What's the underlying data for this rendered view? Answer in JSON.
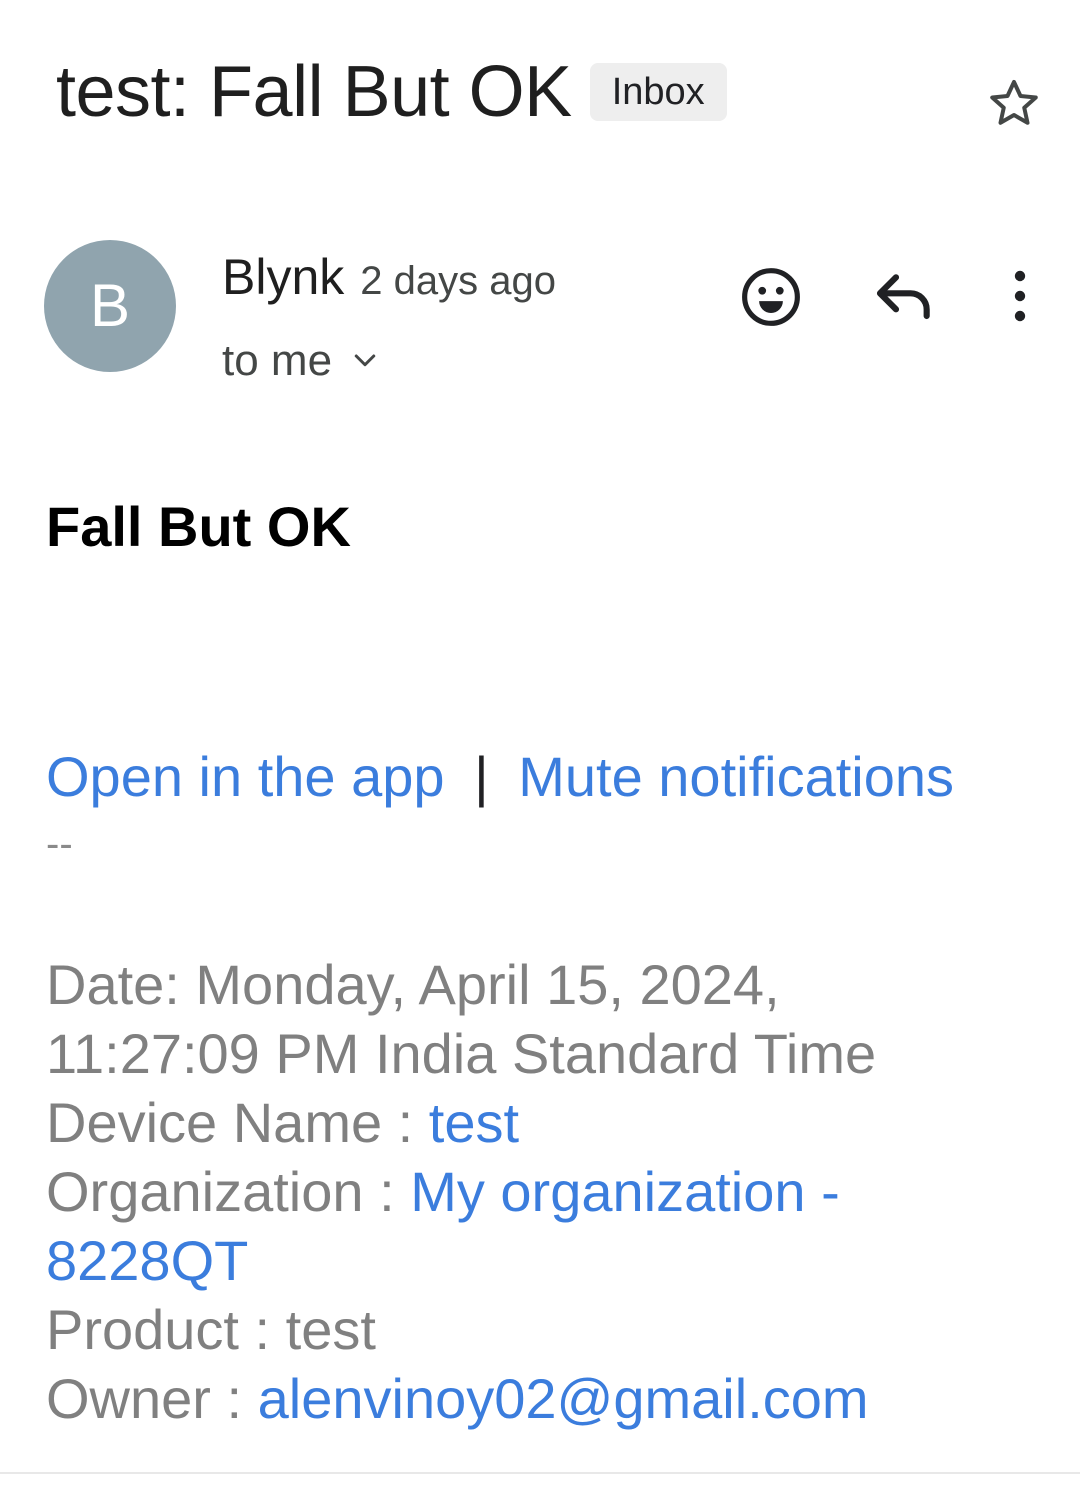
{
  "header": {
    "subject": "test: Fall But OK",
    "label": "Inbox"
  },
  "sender": {
    "initial": "B",
    "name": "Blynk",
    "time": "2 days ago",
    "recipient": "to me",
    "avatar_color": "#90a4ae"
  },
  "icons": {
    "star": "star-icon",
    "emoji": "emoji-icon",
    "reply": "reply-icon",
    "more": "more-vert-icon",
    "expand": "chevron-down-icon"
  },
  "message": {
    "headline": "Fall But OK",
    "link_open": "Open in the app",
    "separator": "|",
    "link_mute": "Mute notifications",
    "signature_dashes": "--",
    "date_label": "Date: Monday, April 15, 2024,",
    "date_time": "11:27:09 PM India Standard Time",
    "device_label": "Device Name : ",
    "device_value": "test",
    "org_label": "Organization : ",
    "org_value_line1": "My organization -",
    "org_value_line2": "8228QT",
    "product_line": "Product : test",
    "owner_label": "Owner : ",
    "owner_value": "alenvinoy02@gmail.com"
  },
  "colors": {
    "link": "#3b7ddd",
    "muted_text": "#808080"
  }
}
